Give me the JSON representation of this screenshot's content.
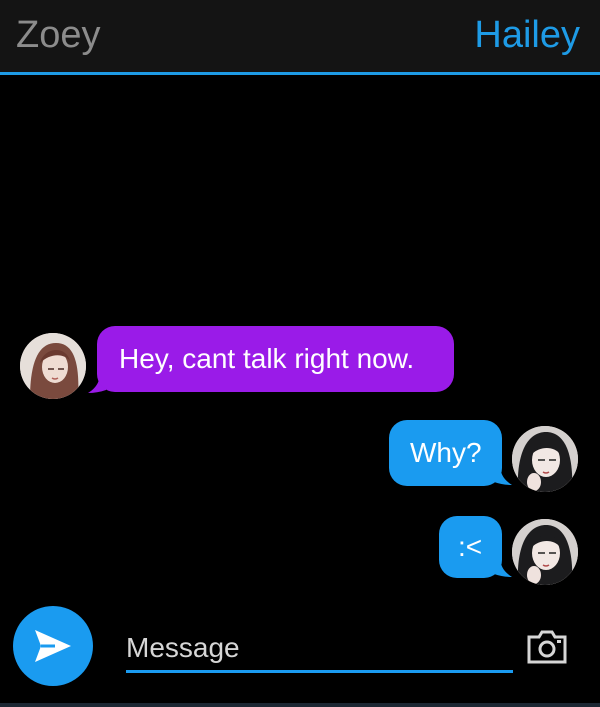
{
  "header": {
    "contact_left": "Zoey",
    "contact_right": "Hailey"
  },
  "messages": [
    {
      "sender": "Zoey",
      "direction": "incoming",
      "text": "Hey, cant talk right now."
    },
    {
      "sender": "Hailey",
      "direction": "outgoing",
      "text": "Why?"
    },
    {
      "sender": "Hailey",
      "direction": "outgoing",
      "text": ":<"
    }
  ],
  "composer": {
    "placeholder": "Message",
    "send_icon": "send-arrow-icon",
    "camera_icon": "camera-icon"
  },
  "colors": {
    "accent": "#1e9be6",
    "incoming_bubble": "#9a1be8",
    "outgoing_bubble": "#1a9bf0",
    "background": "#000000",
    "header_bg": "#141414"
  }
}
